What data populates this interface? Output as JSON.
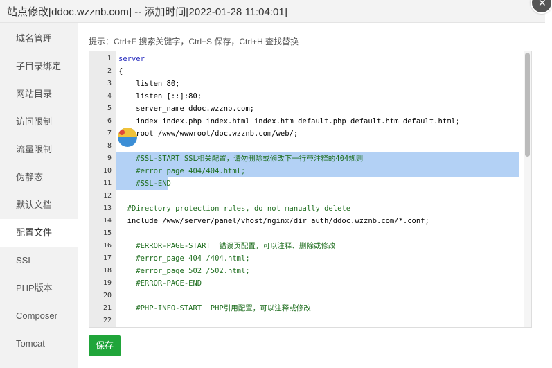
{
  "dialog": {
    "title": "站点修改[ddoc.wzznb.com] -- 添加时间[2022-01-28 11:04:01]",
    "close_icon": "close-icon"
  },
  "sidebar": {
    "items": [
      {
        "label": "域名管理"
      },
      {
        "label": "子目录绑定"
      },
      {
        "label": "网站目录"
      },
      {
        "label": "访问限制"
      },
      {
        "label": "流量限制"
      },
      {
        "label": "伪静态"
      },
      {
        "label": "默认文档"
      },
      {
        "label": "配置文件",
        "active": true
      },
      {
        "label": "SSL"
      },
      {
        "label": "PHP版本"
      },
      {
        "label": "Composer"
      },
      {
        "label": "Tomcat"
      }
    ]
  },
  "hint": "提示：Ctrl+F 搜索关键字，Ctrl+S 保存，Ctrl+H 查找替换",
  "editor": {
    "lines": [
      {
        "n": "1",
        "text": "server"
      },
      {
        "n": "2",
        "text": "{"
      },
      {
        "n": "3",
        "text": "    listen 80;"
      },
      {
        "n": "4",
        "text": "    listen [::]:80;"
      },
      {
        "n": "5",
        "text": "    server_name ddoc.wzznb.com;"
      },
      {
        "n": "6",
        "text": "    index index.php index.html index.htm default.php default.htm default.html;"
      },
      {
        "n": "7",
        "text": "    root /www/wwwroot/doc.wzznb.com/web/;"
      },
      {
        "n": "8",
        "text": ""
      },
      {
        "n": "9",
        "text": "    #SSL-START SSL相关配置，请勿删除或修改下一行带注释的404规则"
      },
      {
        "n": "10",
        "text": "    #error_page 404/404.html;"
      },
      {
        "n": "11",
        "text": "    #SSL-END"
      },
      {
        "n": "12",
        "text": ""
      },
      {
        "n": "13",
        "text": "  #Directory protection rules, do not manually delete"
      },
      {
        "n": "14",
        "text": "  include /www/server/panel/vhost/nginx/dir_auth/ddoc.wzznb.com/*.conf;"
      },
      {
        "n": "15",
        "text": ""
      },
      {
        "n": "16",
        "text": "    #ERROR-PAGE-START  错误页配置，可以注释、删除或修改"
      },
      {
        "n": "17",
        "text": "    #error_page 404 /404.html;"
      },
      {
        "n": "18",
        "text": "    #error_page 502 /502.html;"
      },
      {
        "n": "19",
        "text": "    #ERROR-PAGE-END"
      },
      {
        "n": "20",
        "text": ""
      },
      {
        "n": "21",
        "text": "    #PHP-INFO-START  PHP引用配置，可以注释或修改"
      },
      {
        "n": "22",
        "text": ""
      }
    ],
    "colors": {
      "keyword": "#2a2fbf",
      "comment": "#1f6e1f",
      "selection": "#b3d1f5"
    }
  },
  "save_button": {
    "label": "保存",
    "color": "#20a53a"
  }
}
